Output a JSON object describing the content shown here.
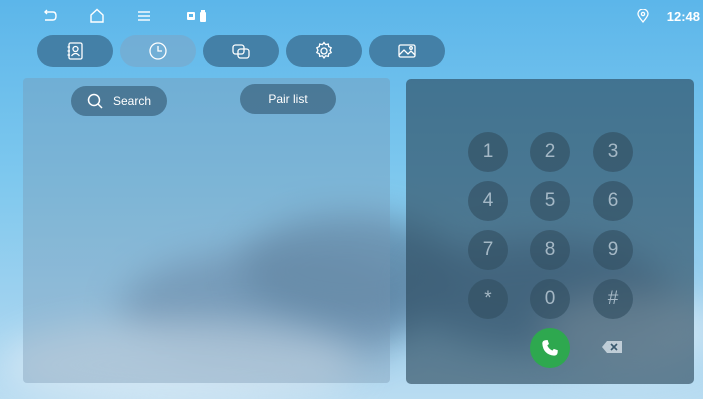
{
  "status_bar": {
    "time": "12:48",
    "icons": [
      "back-icon",
      "home-icon",
      "menu-icon",
      "notification-icons",
      "location-icon"
    ]
  },
  "tabs": [
    {
      "id": "contacts",
      "icon": "contacts-icon",
      "active": false
    },
    {
      "id": "recents",
      "icon": "clock-icon",
      "active": true
    },
    {
      "id": "pairing",
      "icon": "link-icon",
      "active": false
    },
    {
      "id": "settings",
      "icon": "gear-icon",
      "active": false
    },
    {
      "id": "gallery",
      "icon": "image-icon",
      "active": false
    }
  ],
  "left_panel": {
    "search_label": "Search",
    "pair_list_label": "Pair list"
  },
  "dialpad": {
    "keys": [
      "1",
      "2",
      "3",
      "4",
      "5",
      "6",
      "7",
      "8",
      "9",
      "*",
      "0",
      "#"
    ],
    "call_icon": "phone-icon",
    "delete_icon": "backspace-icon",
    "call_color": "#2ea84f"
  },
  "colors": {
    "accent": "#2ea84f",
    "panel": "#3c647f"
  }
}
